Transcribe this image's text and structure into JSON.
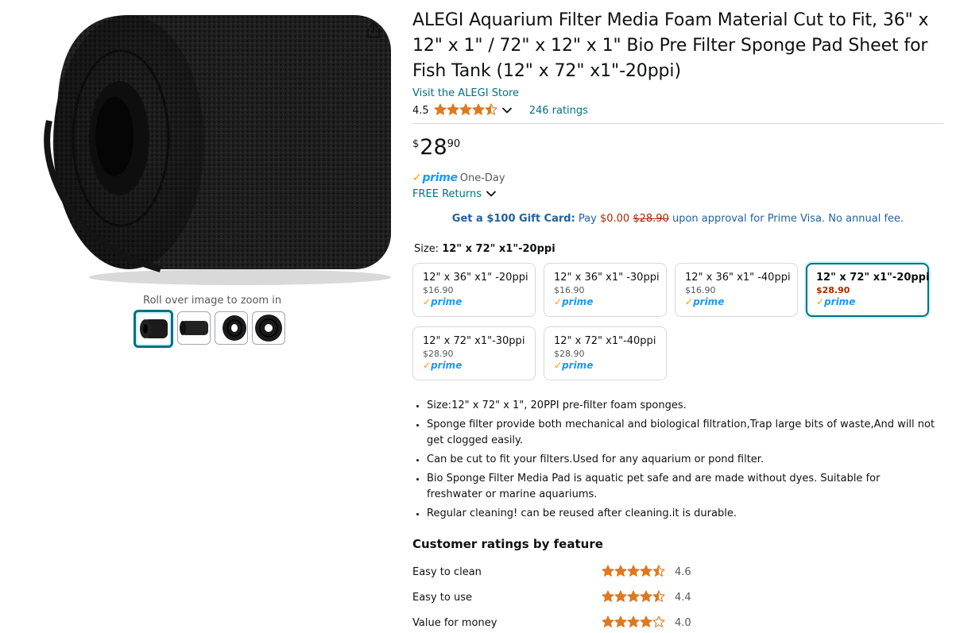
{
  "product": {
    "title": "ALEGI Aquarium Filter Media Foam Material Cut to Fit, 36\" x 12\" x 1\" / 72\" x 12\" x 1\" Bio Pre Filter Sponge Pad Sheet for Fish Tank (12\" x 72\" x1\"-20ppi)",
    "store_link": "Visit the ALEGI Store",
    "rating_value": "4.5",
    "rating_stars": 4.5,
    "ratings_count": "246 ratings"
  },
  "gallery": {
    "zoom_hint": "Roll over image to zoom in",
    "thumbnails": [
      "roll-front",
      "roll-side",
      "roll-end",
      "roll-top"
    ],
    "selected_index": 0
  },
  "price": {
    "symbol": "$",
    "whole": "28",
    "fraction": "90"
  },
  "delivery": {
    "prime_label": "prime",
    "prime_speed": "One-Day",
    "returns": "FREE Returns"
  },
  "giftcard": {
    "bold": "Get a $100 Gift Card:",
    "pay": "Pay",
    "zero": "$0.00",
    "strike": "$28.90",
    "rest": "upon approval for Prime Visa. No annual fee."
  },
  "size": {
    "label": "Size:",
    "selected": "12\" x 72\" x1\"-20ppi",
    "options": [
      {
        "name": "12\" x 36\" x1\" -20ppi",
        "price": "$16.90",
        "prime": "prime"
      },
      {
        "name": "12\" x 36\" x1\" -30ppi",
        "price": "$16.90",
        "prime": "prime"
      },
      {
        "name": "12\" x 36\" x1\" -40ppi",
        "price": "$16.90",
        "prime": "prime"
      },
      {
        "name": "12\" x 72\" x1\"-20ppi",
        "price": "$28.90",
        "prime": "prime"
      },
      {
        "name": "12\" x 72\" x1\"-30ppi",
        "price": "$28.90",
        "prime": "prime"
      },
      {
        "name": "12\" x 72\" x1\"-40ppi",
        "price": "$28.90",
        "prime": "prime"
      }
    ],
    "selected_index": 3
  },
  "bullets": [
    "Size:12\" x 72\" x 1\", 20PPI pre-filter foam sponges.",
    "Sponge filter provide both mechanical and biological filtration,Trap large bits of waste,And will not get clogged easily.",
    "Can be cut to fit your filters.Used for any aquarium or pond filter.",
    "Bio Sponge Filter Media Pad is aquatic pet safe and are made without dyes. Suitable for freshwater or marine aquariums.",
    "Regular cleaning! can be reused after cleaning.it is durable."
  ],
  "features": {
    "title": "Customer ratings by feature",
    "items": [
      {
        "name": "Easy to clean",
        "value": "4.6",
        "stars": 4.5
      },
      {
        "name": "Easy to use",
        "value": "4.4",
        "stars": 4.5
      },
      {
        "name": "Value for money",
        "value": "4.0",
        "stars": 4.0
      }
    ]
  },
  "colors": {
    "link": "#007185",
    "star": "#de7921",
    "price_red": "#b12704",
    "prime_blue": "#1a98ff",
    "prime_check": "#ff9900"
  },
  "icons": {
    "share": "share-icon",
    "chevron": "chevron-down-icon",
    "star": "star-icon"
  }
}
